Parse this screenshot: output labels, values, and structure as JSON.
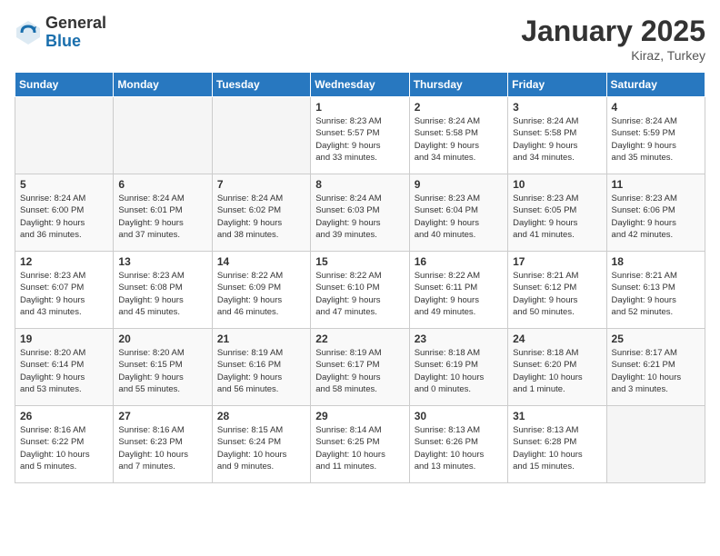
{
  "header": {
    "logo_general": "General",
    "logo_blue": "Blue",
    "month": "January 2025",
    "location": "Kiraz, Turkey"
  },
  "weekdays": [
    "Sunday",
    "Monday",
    "Tuesday",
    "Wednesday",
    "Thursday",
    "Friday",
    "Saturday"
  ],
  "weeks": [
    [
      {
        "day": "",
        "info": ""
      },
      {
        "day": "",
        "info": ""
      },
      {
        "day": "",
        "info": ""
      },
      {
        "day": "1",
        "info": "Sunrise: 8:23 AM\nSunset: 5:57 PM\nDaylight: 9 hours\nand 33 minutes."
      },
      {
        "day": "2",
        "info": "Sunrise: 8:24 AM\nSunset: 5:58 PM\nDaylight: 9 hours\nand 34 minutes."
      },
      {
        "day": "3",
        "info": "Sunrise: 8:24 AM\nSunset: 5:58 PM\nDaylight: 9 hours\nand 34 minutes."
      },
      {
        "day": "4",
        "info": "Sunrise: 8:24 AM\nSunset: 5:59 PM\nDaylight: 9 hours\nand 35 minutes."
      }
    ],
    [
      {
        "day": "5",
        "info": "Sunrise: 8:24 AM\nSunset: 6:00 PM\nDaylight: 9 hours\nand 36 minutes."
      },
      {
        "day": "6",
        "info": "Sunrise: 8:24 AM\nSunset: 6:01 PM\nDaylight: 9 hours\nand 37 minutes."
      },
      {
        "day": "7",
        "info": "Sunrise: 8:24 AM\nSunset: 6:02 PM\nDaylight: 9 hours\nand 38 minutes."
      },
      {
        "day": "8",
        "info": "Sunrise: 8:24 AM\nSunset: 6:03 PM\nDaylight: 9 hours\nand 39 minutes."
      },
      {
        "day": "9",
        "info": "Sunrise: 8:23 AM\nSunset: 6:04 PM\nDaylight: 9 hours\nand 40 minutes."
      },
      {
        "day": "10",
        "info": "Sunrise: 8:23 AM\nSunset: 6:05 PM\nDaylight: 9 hours\nand 41 minutes."
      },
      {
        "day": "11",
        "info": "Sunrise: 8:23 AM\nSunset: 6:06 PM\nDaylight: 9 hours\nand 42 minutes."
      }
    ],
    [
      {
        "day": "12",
        "info": "Sunrise: 8:23 AM\nSunset: 6:07 PM\nDaylight: 9 hours\nand 43 minutes."
      },
      {
        "day": "13",
        "info": "Sunrise: 8:23 AM\nSunset: 6:08 PM\nDaylight: 9 hours\nand 45 minutes."
      },
      {
        "day": "14",
        "info": "Sunrise: 8:22 AM\nSunset: 6:09 PM\nDaylight: 9 hours\nand 46 minutes."
      },
      {
        "day": "15",
        "info": "Sunrise: 8:22 AM\nSunset: 6:10 PM\nDaylight: 9 hours\nand 47 minutes."
      },
      {
        "day": "16",
        "info": "Sunrise: 8:22 AM\nSunset: 6:11 PM\nDaylight: 9 hours\nand 49 minutes."
      },
      {
        "day": "17",
        "info": "Sunrise: 8:21 AM\nSunset: 6:12 PM\nDaylight: 9 hours\nand 50 minutes."
      },
      {
        "day": "18",
        "info": "Sunrise: 8:21 AM\nSunset: 6:13 PM\nDaylight: 9 hours\nand 52 minutes."
      }
    ],
    [
      {
        "day": "19",
        "info": "Sunrise: 8:20 AM\nSunset: 6:14 PM\nDaylight: 9 hours\nand 53 minutes."
      },
      {
        "day": "20",
        "info": "Sunrise: 8:20 AM\nSunset: 6:15 PM\nDaylight: 9 hours\nand 55 minutes."
      },
      {
        "day": "21",
        "info": "Sunrise: 8:19 AM\nSunset: 6:16 PM\nDaylight: 9 hours\nand 56 minutes."
      },
      {
        "day": "22",
        "info": "Sunrise: 8:19 AM\nSunset: 6:17 PM\nDaylight: 9 hours\nand 58 minutes."
      },
      {
        "day": "23",
        "info": "Sunrise: 8:18 AM\nSunset: 6:19 PM\nDaylight: 10 hours\nand 0 minutes."
      },
      {
        "day": "24",
        "info": "Sunrise: 8:18 AM\nSunset: 6:20 PM\nDaylight: 10 hours\nand 1 minute."
      },
      {
        "day": "25",
        "info": "Sunrise: 8:17 AM\nSunset: 6:21 PM\nDaylight: 10 hours\nand 3 minutes."
      }
    ],
    [
      {
        "day": "26",
        "info": "Sunrise: 8:16 AM\nSunset: 6:22 PM\nDaylight: 10 hours\nand 5 minutes."
      },
      {
        "day": "27",
        "info": "Sunrise: 8:16 AM\nSunset: 6:23 PM\nDaylight: 10 hours\nand 7 minutes."
      },
      {
        "day": "28",
        "info": "Sunrise: 8:15 AM\nSunset: 6:24 PM\nDaylight: 10 hours\nand 9 minutes."
      },
      {
        "day": "29",
        "info": "Sunrise: 8:14 AM\nSunset: 6:25 PM\nDaylight: 10 hours\nand 11 minutes."
      },
      {
        "day": "30",
        "info": "Sunrise: 8:13 AM\nSunset: 6:26 PM\nDaylight: 10 hours\nand 13 minutes."
      },
      {
        "day": "31",
        "info": "Sunrise: 8:13 AM\nSunset: 6:28 PM\nDaylight: 10 hours\nand 15 minutes."
      },
      {
        "day": "",
        "info": ""
      }
    ]
  ]
}
